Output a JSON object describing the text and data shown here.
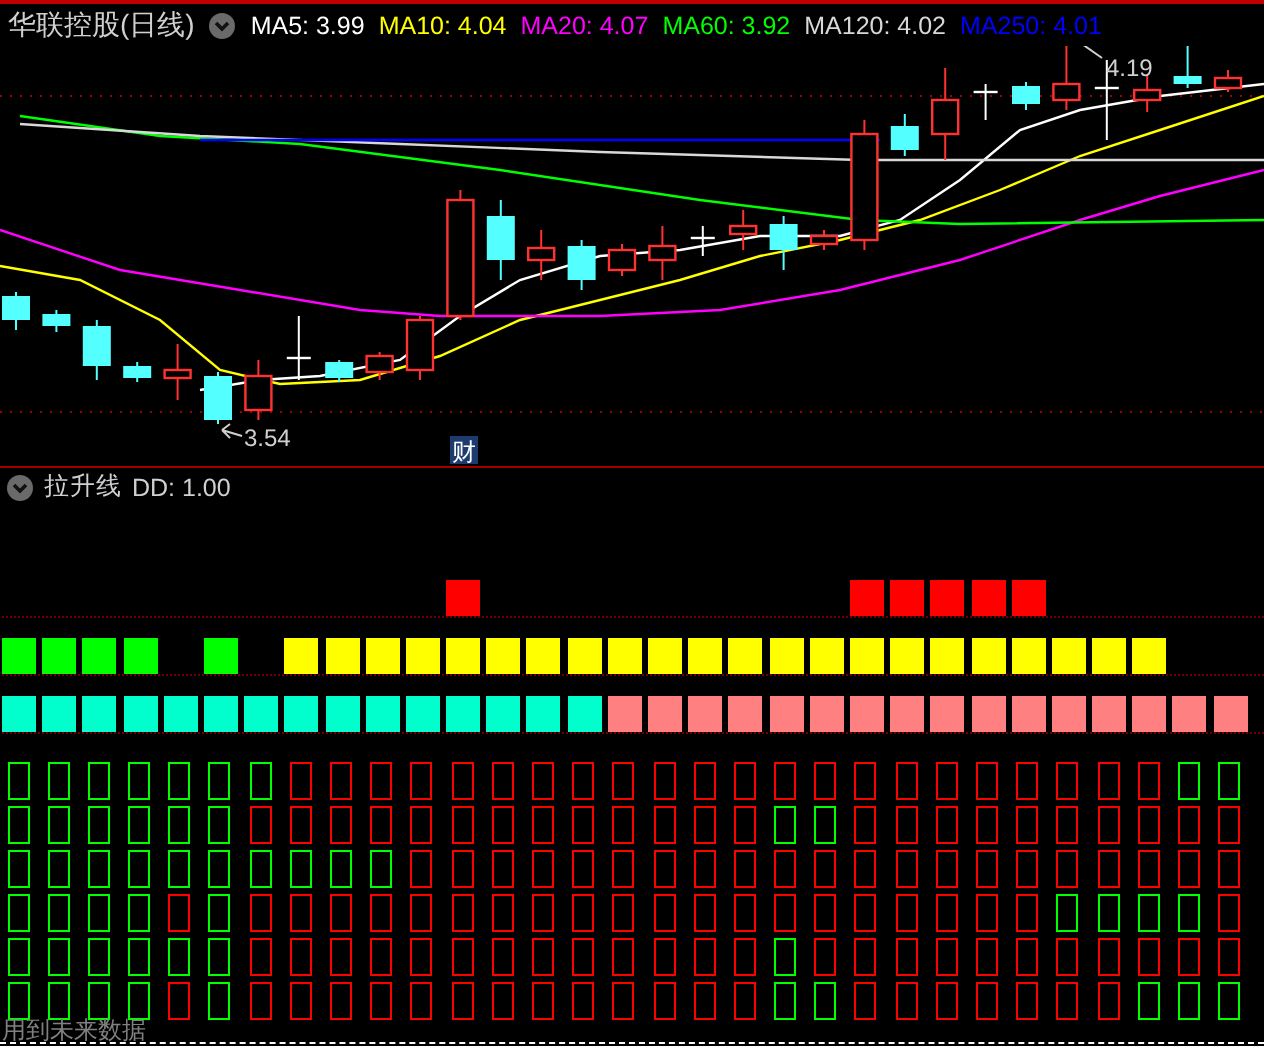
{
  "chart_header": {
    "stock_name": "华联控股(日线)",
    "ma_readouts": [
      {
        "label": "MA5: 3.99",
        "color": "#ffffff"
      },
      {
        "label": "MA10: 4.04",
        "color": "#ffff00"
      },
      {
        "label": "MA20: 4.07",
        "color": "#ff00ff"
      },
      {
        "label": "MA60: 3.92",
        "color": "#00ff00"
      },
      {
        "label": "MA120: 4.02",
        "color": "#d8d8d8"
      },
      {
        "label": "MA250: 4.01",
        "color": "#0000ff"
      }
    ]
  },
  "price_chart": {
    "high_marker": "4.19",
    "low_marker": "3.54",
    "event_tag": "财"
  },
  "indicator": {
    "name": "拉升线",
    "parameter": "DD: 1.00",
    "bar_rows": [
      {
        "cells": [
          {
            "kind": "gap"
          },
          {
            "kind": "gap"
          },
          {
            "kind": "gap"
          },
          {
            "kind": "gap"
          },
          {
            "kind": "gap"
          },
          {
            "kind": "gap"
          },
          {
            "kind": "gap"
          },
          {
            "kind": "gap"
          },
          {
            "kind": "gap"
          },
          {
            "kind": "gap"
          },
          {
            "kind": "gap"
          },
          {
            "kind": "block",
            "color": "#ff0000"
          },
          {
            "kind": "gap"
          },
          {
            "kind": "gap"
          },
          {
            "kind": "gap"
          },
          {
            "kind": "gap"
          },
          {
            "kind": "gap"
          },
          {
            "kind": "gap"
          },
          {
            "kind": "gap"
          },
          {
            "kind": "gap"
          },
          {
            "kind": "gap"
          },
          {
            "kind": "block",
            "color": "#ff0000"
          },
          {
            "kind": "block",
            "color": "#ff0000"
          },
          {
            "kind": "block",
            "color": "#ff0000"
          },
          {
            "kind": "block",
            "color": "#ff0000"
          },
          {
            "kind": "block",
            "color": "#ff0000"
          },
          {
            "kind": "gap"
          },
          {
            "kind": "gap"
          },
          {
            "kind": "gap"
          },
          {
            "kind": "gap"
          },
          {
            "kind": "gap"
          }
        ]
      },
      {
        "cells": [
          {
            "kind": "block",
            "color": "#00ff00"
          },
          {
            "kind": "block",
            "color": "#00ff00"
          },
          {
            "kind": "block",
            "color": "#00ff00"
          },
          {
            "kind": "block",
            "color": "#00ff00"
          },
          {
            "kind": "gap"
          },
          {
            "kind": "block",
            "color": "#00ff00"
          },
          {
            "kind": "gap"
          },
          {
            "kind": "block",
            "color": "#ffff00"
          },
          {
            "kind": "block",
            "color": "#ffff00"
          },
          {
            "kind": "block",
            "color": "#ffff00"
          },
          {
            "kind": "block",
            "color": "#ffff00"
          },
          {
            "kind": "block",
            "color": "#ffff00"
          },
          {
            "kind": "block",
            "color": "#ffff00"
          },
          {
            "kind": "block",
            "color": "#ffff00"
          },
          {
            "kind": "block",
            "color": "#ffff00"
          },
          {
            "kind": "block",
            "color": "#ffff00"
          },
          {
            "kind": "block",
            "color": "#ffff00"
          },
          {
            "kind": "block",
            "color": "#ffff00"
          },
          {
            "kind": "block",
            "color": "#ffff00"
          },
          {
            "kind": "block",
            "color": "#ffff00"
          },
          {
            "kind": "block",
            "color": "#ffff00"
          },
          {
            "kind": "block",
            "color": "#ffff00"
          },
          {
            "kind": "block",
            "color": "#ffff00"
          },
          {
            "kind": "block",
            "color": "#ffff00"
          },
          {
            "kind": "block",
            "color": "#ffff00"
          },
          {
            "kind": "block",
            "color": "#ffff00"
          },
          {
            "kind": "block",
            "color": "#ffff00"
          },
          {
            "kind": "block",
            "color": "#ffff00"
          },
          {
            "kind": "block",
            "color": "#ffff00"
          },
          {
            "kind": "gap"
          },
          {
            "kind": "gap"
          }
        ]
      },
      {
        "cells": [
          {
            "kind": "block",
            "color": "#00ffcc"
          },
          {
            "kind": "block",
            "color": "#00ffcc"
          },
          {
            "kind": "block",
            "color": "#00ffcc"
          },
          {
            "kind": "block",
            "color": "#00ffcc"
          },
          {
            "kind": "block",
            "color": "#00ffcc"
          },
          {
            "kind": "block",
            "color": "#00ffcc"
          },
          {
            "kind": "block",
            "color": "#00ffcc"
          },
          {
            "kind": "block",
            "color": "#00ffcc"
          },
          {
            "kind": "block",
            "color": "#00ffcc"
          },
          {
            "kind": "block",
            "color": "#00ffcc"
          },
          {
            "kind": "block",
            "color": "#00ffcc"
          },
          {
            "kind": "block",
            "color": "#00ffcc"
          },
          {
            "kind": "block",
            "color": "#00ffcc"
          },
          {
            "kind": "block",
            "color": "#00ffcc"
          },
          {
            "kind": "block",
            "color": "#00ffcc"
          },
          {
            "kind": "block",
            "color": "#ff8080"
          },
          {
            "kind": "block",
            "color": "#ff8080"
          },
          {
            "kind": "block",
            "color": "#ff8080"
          },
          {
            "kind": "block",
            "color": "#ff8080"
          },
          {
            "kind": "block",
            "color": "#ff8080"
          },
          {
            "kind": "block",
            "color": "#ff8080"
          },
          {
            "kind": "block",
            "color": "#ff8080"
          },
          {
            "kind": "block",
            "color": "#ff8080"
          },
          {
            "kind": "block",
            "color": "#ff8080"
          },
          {
            "kind": "block",
            "color": "#ff8080"
          },
          {
            "kind": "block",
            "color": "#ff8080"
          },
          {
            "kind": "block",
            "color": "#ff8080"
          },
          {
            "kind": "block",
            "color": "#ff8080"
          },
          {
            "kind": "block",
            "color": "#ff8080"
          },
          {
            "kind": "block",
            "color": "#ff8080"
          },
          {
            "kind": "block",
            "color": "#ff8080"
          }
        ]
      }
    ],
    "box_rows": [
      {
        "cells": [
          {
            "color": "#00ff00"
          },
          {
            "color": "#00ff00"
          },
          {
            "color": "#00ff00"
          },
          {
            "color": "#00ff00"
          },
          {
            "color": "#00ff00"
          },
          {
            "color": "#00ff00"
          },
          {
            "color": "#00ff00"
          },
          {
            "color": "#ff0000"
          },
          {
            "color": "#ff0000"
          },
          {
            "color": "#ff0000"
          },
          {
            "color": "#ff0000"
          },
          {
            "color": "#ff0000"
          },
          {
            "color": "#ff0000"
          },
          {
            "color": "#ff0000"
          },
          {
            "color": "#ff0000"
          },
          {
            "color": "#ff0000"
          },
          {
            "color": "#ff0000"
          },
          {
            "color": "#ff0000"
          },
          {
            "color": "#ff0000"
          },
          {
            "color": "#ff0000"
          },
          {
            "color": "#ff0000"
          },
          {
            "color": "#ff0000"
          },
          {
            "color": "#ff0000"
          },
          {
            "color": "#ff0000"
          },
          {
            "color": "#ff0000"
          },
          {
            "color": "#ff0000"
          },
          {
            "color": "#ff0000"
          },
          {
            "color": "#ff0000"
          },
          {
            "color": "#ff0000"
          },
          {
            "color": "#00ff00"
          },
          {
            "color": "#00ff00"
          }
        ]
      },
      {
        "cells": [
          {
            "color": "#00ff00"
          },
          {
            "color": "#00ff00"
          },
          {
            "color": "#00ff00"
          },
          {
            "color": "#00ff00"
          },
          {
            "color": "#00ff00"
          },
          {
            "color": "#00ff00"
          },
          {
            "color": "#ff0000"
          },
          {
            "color": "#ff0000"
          },
          {
            "color": "#ff0000"
          },
          {
            "color": "#ff0000"
          },
          {
            "color": "#ff0000"
          },
          {
            "color": "#ff0000"
          },
          {
            "color": "#ff0000"
          },
          {
            "color": "#ff0000"
          },
          {
            "color": "#ff0000"
          },
          {
            "color": "#ff0000"
          },
          {
            "color": "#ff0000"
          },
          {
            "color": "#ff0000"
          },
          {
            "color": "#ff0000"
          },
          {
            "color": "#00ff00"
          },
          {
            "color": "#00ff00"
          },
          {
            "color": "#ff0000"
          },
          {
            "color": "#ff0000"
          },
          {
            "color": "#ff0000"
          },
          {
            "color": "#ff0000"
          },
          {
            "color": "#ff0000"
          },
          {
            "color": "#ff0000"
          },
          {
            "color": "#ff0000"
          },
          {
            "color": "#ff0000"
          },
          {
            "color": "#ff0000"
          },
          {
            "color": "#ff0000"
          }
        ]
      },
      {
        "cells": [
          {
            "color": "#00ff00"
          },
          {
            "color": "#00ff00"
          },
          {
            "color": "#00ff00"
          },
          {
            "color": "#00ff00"
          },
          {
            "color": "#00ff00"
          },
          {
            "color": "#00ff00"
          },
          {
            "color": "#00ff00"
          },
          {
            "color": "#00ff00"
          },
          {
            "color": "#00ff00"
          },
          {
            "color": "#00ff00"
          },
          {
            "color": "#ff0000"
          },
          {
            "color": "#ff0000"
          },
          {
            "color": "#ff0000"
          },
          {
            "color": "#ff0000"
          },
          {
            "color": "#ff0000"
          },
          {
            "color": "#ff0000"
          },
          {
            "color": "#ff0000"
          },
          {
            "color": "#ff0000"
          },
          {
            "color": "#ff0000"
          },
          {
            "color": "#ff0000"
          },
          {
            "color": "#ff0000"
          },
          {
            "color": "#ff0000"
          },
          {
            "color": "#ff0000"
          },
          {
            "color": "#ff0000"
          },
          {
            "color": "#ff0000"
          },
          {
            "color": "#ff0000"
          },
          {
            "color": "#ff0000"
          },
          {
            "color": "#ff0000"
          },
          {
            "color": "#ff0000"
          },
          {
            "color": "#ff0000"
          },
          {
            "color": "#ff0000"
          }
        ]
      },
      {
        "cells": [
          {
            "color": "#00ff00"
          },
          {
            "color": "#00ff00"
          },
          {
            "color": "#00ff00"
          },
          {
            "color": "#00ff00"
          },
          {
            "color": "#ff0000"
          },
          {
            "color": "#00ff00"
          },
          {
            "color": "#ff0000"
          },
          {
            "color": "#ff0000"
          },
          {
            "color": "#ff0000"
          },
          {
            "color": "#ff0000"
          },
          {
            "color": "#ff0000"
          },
          {
            "color": "#ff0000"
          },
          {
            "color": "#ff0000"
          },
          {
            "color": "#ff0000"
          },
          {
            "color": "#ff0000"
          },
          {
            "color": "#ff0000"
          },
          {
            "color": "#ff0000"
          },
          {
            "color": "#ff0000"
          },
          {
            "color": "#ff0000"
          },
          {
            "color": "#ff0000"
          },
          {
            "color": "#ff0000"
          },
          {
            "color": "#ff0000"
          },
          {
            "color": "#ff0000"
          },
          {
            "color": "#ff0000"
          },
          {
            "color": "#ff0000"
          },
          {
            "color": "#ff0000"
          },
          {
            "color": "#00ff00"
          },
          {
            "color": "#00ff00"
          },
          {
            "color": "#00ff00"
          },
          {
            "color": "#00ff00"
          },
          {
            "color": "#ff0000"
          }
        ]
      },
      {
        "cells": [
          {
            "color": "#00ff00"
          },
          {
            "color": "#00ff00"
          },
          {
            "color": "#00ff00"
          },
          {
            "color": "#00ff00"
          },
          {
            "color": "#00ff00"
          },
          {
            "color": "#00ff00"
          },
          {
            "color": "#ff0000"
          },
          {
            "color": "#ff0000"
          },
          {
            "color": "#ff0000"
          },
          {
            "color": "#ff0000"
          },
          {
            "color": "#ff0000"
          },
          {
            "color": "#ff0000"
          },
          {
            "color": "#ff0000"
          },
          {
            "color": "#ff0000"
          },
          {
            "color": "#ff0000"
          },
          {
            "color": "#ff0000"
          },
          {
            "color": "#ff0000"
          },
          {
            "color": "#ff0000"
          },
          {
            "color": "#ff0000"
          },
          {
            "color": "#00ff00"
          },
          {
            "color": "#ff0000"
          },
          {
            "color": "#ff0000"
          },
          {
            "color": "#ff0000"
          },
          {
            "color": "#ff0000"
          },
          {
            "color": "#ff0000"
          },
          {
            "color": "#ff0000"
          },
          {
            "color": "#ff0000"
          },
          {
            "color": "#ff0000"
          },
          {
            "color": "#ff0000"
          },
          {
            "color": "#ff0000"
          },
          {
            "color": "#ff0000"
          }
        ]
      },
      {
        "cells": [
          {
            "color": "#00ff00"
          },
          {
            "color": "#00ff00"
          },
          {
            "color": "#00ff00"
          },
          {
            "color": "#00ff00"
          },
          {
            "color": "#ff0000"
          },
          {
            "color": "#00ff00"
          },
          {
            "color": "#ff0000"
          },
          {
            "color": "#ff0000"
          },
          {
            "color": "#ff0000"
          },
          {
            "color": "#ff0000"
          },
          {
            "color": "#ff0000"
          },
          {
            "color": "#ff0000"
          },
          {
            "color": "#ff0000"
          },
          {
            "color": "#ff0000"
          },
          {
            "color": "#ff0000"
          },
          {
            "color": "#ff0000"
          },
          {
            "color": "#ff0000"
          },
          {
            "color": "#ff0000"
          },
          {
            "color": "#ff0000"
          },
          {
            "color": "#00ff00"
          },
          {
            "color": "#00ff00"
          },
          {
            "color": "#ff0000"
          },
          {
            "color": "#ff0000"
          },
          {
            "color": "#ff0000"
          },
          {
            "color": "#ff0000"
          },
          {
            "color": "#ff0000"
          },
          {
            "color": "#ff0000"
          },
          {
            "color": "#ff0000"
          },
          {
            "color": "#00ff00"
          },
          {
            "color": "#00ff00"
          },
          {
            "color": "#00ff00"
          }
        ]
      }
    ]
  },
  "footer_note": "用到未来数据"
}
